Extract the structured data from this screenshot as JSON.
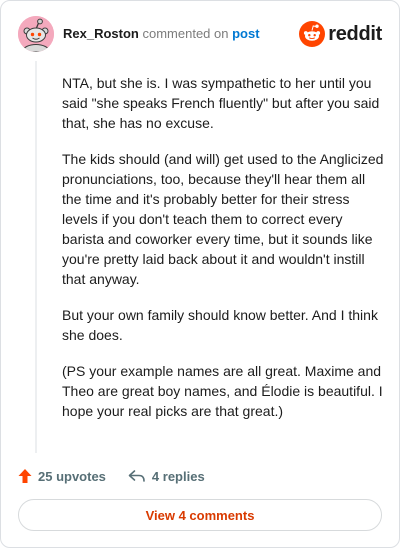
{
  "comment": {
    "username": "Rex_Roston",
    "action_text": "commented on",
    "target_link": "post",
    "paragraphs": [
      "NTA, but she is. I was sympathetic to her until you said \"she speaks French fluently\" but after you said that, she has no excuse.",
      "The kids should (and will) get used to the Anglicized pronunciations, too, because they'll hear them all the time and it's probably better for their stress levels if you don't teach them to correct every barista and coworker every time, but it sounds like you're pretty laid back about it and wouldn't instill that anyway.",
      "But your own family should know better. And I think she does.",
      "(PS your example names are all great. Maxime and Theo are great boy names, and Élodie is beautiful. I hope your real picks are that great.)"
    ],
    "upvotes_label": "25 upvotes",
    "replies_label": "4 replies"
  },
  "brand": {
    "name": "reddit",
    "color": "#ff4500"
  },
  "actions": {
    "view_comments_label": "View 4 comments"
  },
  "colors": {
    "upvote": "#ff4500",
    "link": "#0079d3",
    "button_text": "#d93a00",
    "avatar_bg": "#f4a9bd"
  },
  "icons": {
    "avatar": "snoo-avatar-icon",
    "brand": "reddit-snoo-icon",
    "upvote": "upvote-arrow-icon",
    "reply": "reply-arrow-icon"
  }
}
